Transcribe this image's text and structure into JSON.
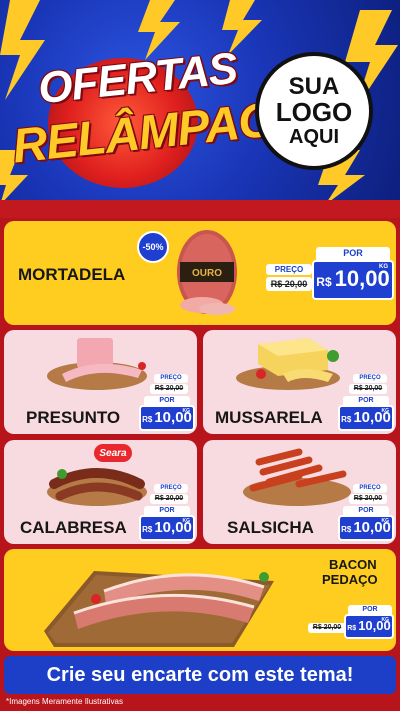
{
  "header": {
    "title_line1": "OFERTAS",
    "title_line2": "RELÂMPAGO",
    "logo_line1": "SUA",
    "logo_line2": "LOGO",
    "logo_line3": "AQUI"
  },
  "featured": {
    "name": "MORTADELA",
    "discount_badge": "-50%",
    "brand_label": "OURO",
    "price_label": "PREÇO",
    "old_price": "R$ 20,00",
    "por_label": "POR",
    "currency": "R$",
    "new_price": "10,00",
    "unit": "KG"
  },
  "products": [
    {
      "name": "PRESUNTO",
      "price_label": "PREÇO",
      "old_price": "R$ 20,00",
      "por_label": "POR",
      "currency": "R$",
      "new_price": "10,00",
      "unit": "KG"
    },
    {
      "name": "MUSSARELA",
      "price_label": "PREÇO",
      "old_price": "R$ 20,00",
      "por_label": "POR",
      "currency": "R$",
      "new_price": "10,00",
      "unit": "KG"
    },
    {
      "name": "CALABRESA",
      "brand": "Seara",
      "price_label": "PREÇO",
      "old_price": "R$ 20,00",
      "por_label": "POR",
      "currency": "R$",
      "new_price": "10,00",
      "unit": "KG"
    },
    {
      "name": "SALSICHA",
      "price_label": "PREÇO",
      "old_price": "R$ 20,00",
      "por_label": "POR",
      "currency": "R$",
      "new_price": "10,00",
      "unit": "KG"
    }
  ],
  "bacon": {
    "name_line1": "BACON",
    "name_line2": "PEDAÇO",
    "por_label": "POR",
    "old_price": "R$ 20,00",
    "currency": "R$",
    "new_price": "10,00",
    "unit": "KG"
  },
  "footer": {
    "cta": "Crie seu encarte com este tema!",
    "disclaimer": "*Imagens Meramente Ilustrativas"
  },
  "colors": {
    "accent_blue": "#1f3fd0",
    "brand_red": "#c21820",
    "highlight_yellow": "#ffcd1f",
    "card_pink": "#f7dbe1"
  }
}
